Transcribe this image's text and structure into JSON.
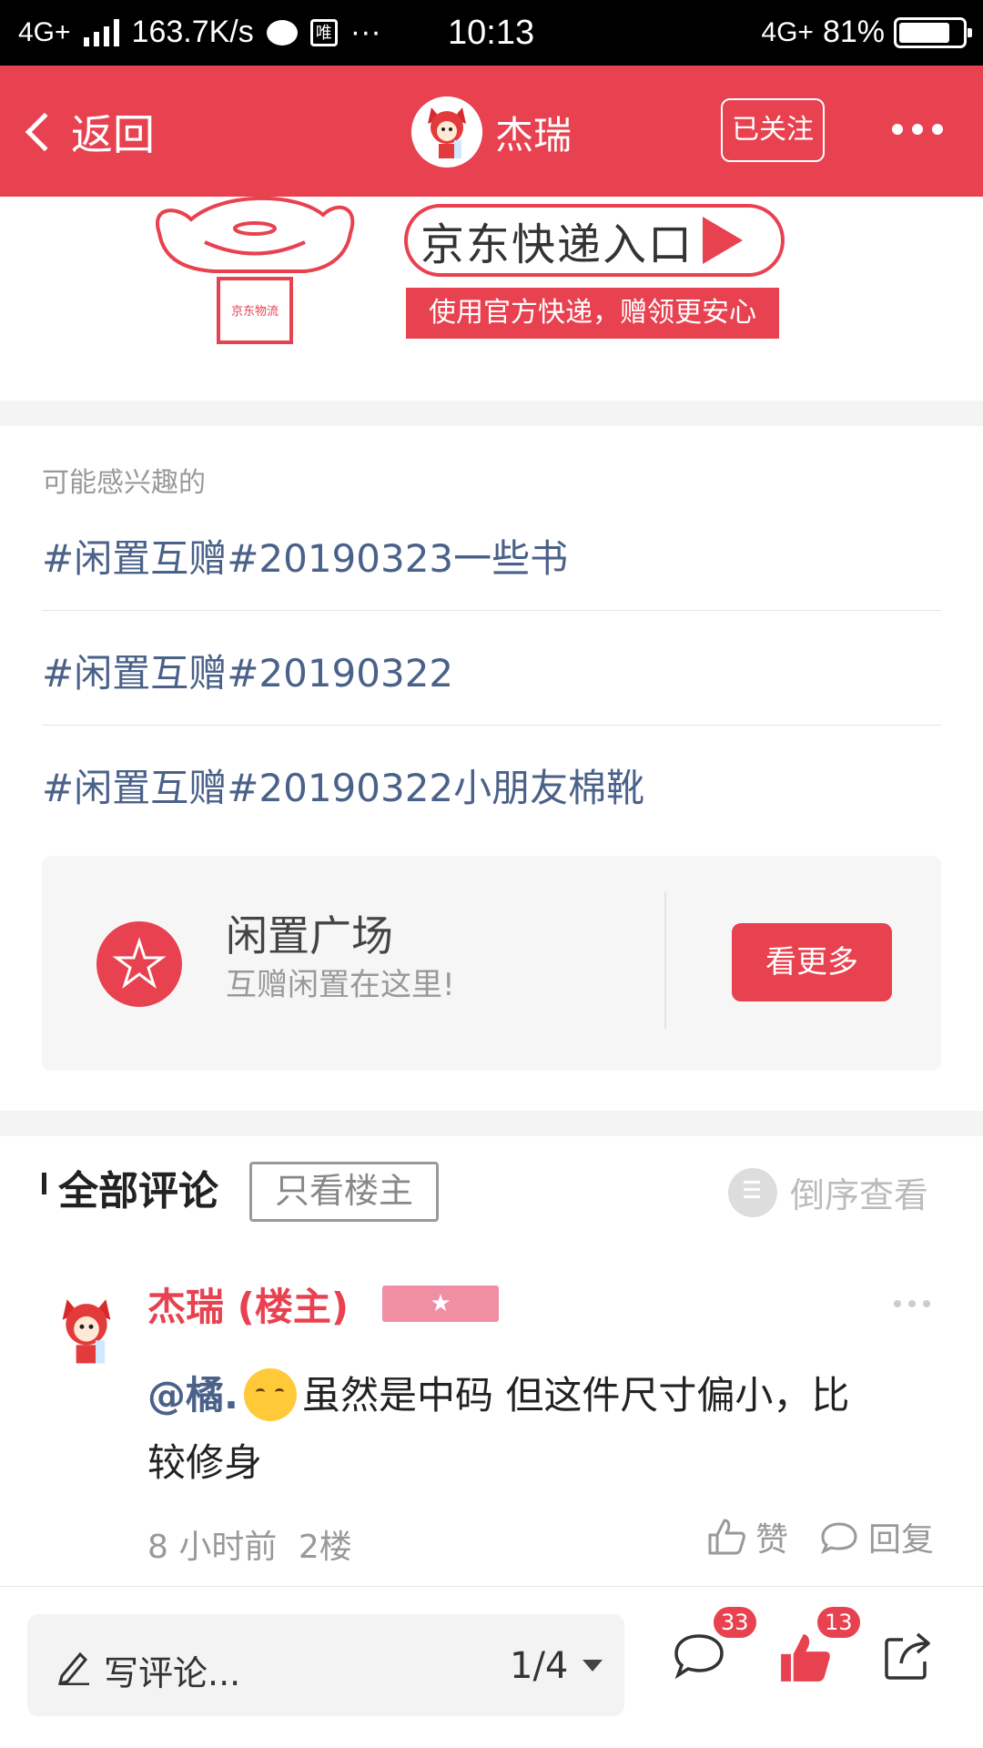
{
  "status_bar": {
    "network": "4G+",
    "speed": "163.7K/s",
    "app_box": "唯",
    "dots": "···",
    "time": "10:13",
    "network_right": "4G+",
    "battery": "81%",
    "battery_level": 0.81
  },
  "nav": {
    "back_label": "返回",
    "user_name": "杰瑞",
    "follow_label": "已关注"
  },
  "banner": {
    "entry_label": "京东快递入口",
    "subtitle": "使用官方快递，赠领更安心",
    "box_label": "京东物流"
  },
  "interests": {
    "title": "可能感兴趣的",
    "topics": [
      "#闲置互赠#20190323一些书",
      "#闲置互赠#20190322",
      "#闲置互赠#20190322小朋友棉靴"
    ]
  },
  "square": {
    "title": "闲置广场",
    "subtitle": "互赠闲置在这里!",
    "button_label": "看更多"
  },
  "comments_header": {
    "title": "全部评论",
    "filter_label": "只看楼主",
    "sort_label": "倒序查看"
  },
  "comment": {
    "author": "杰瑞 (楼主)",
    "mention": "@橘.",
    "text_line1": "虽然是中码 但这件尺寸偏小，比",
    "text_line2": "较修身",
    "time": "8 小时前",
    "floor": "2楼",
    "like_label": "赞",
    "reply_label": "回复"
  },
  "bottom_bar": {
    "composer_placeholder": "写评论...",
    "page_indicator": "1/4",
    "comment_count": "33",
    "like_count": "13"
  },
  "colors": {
    "brand_red": "#e8414f",
    "link_blue": "#4a6189"
  }
}
